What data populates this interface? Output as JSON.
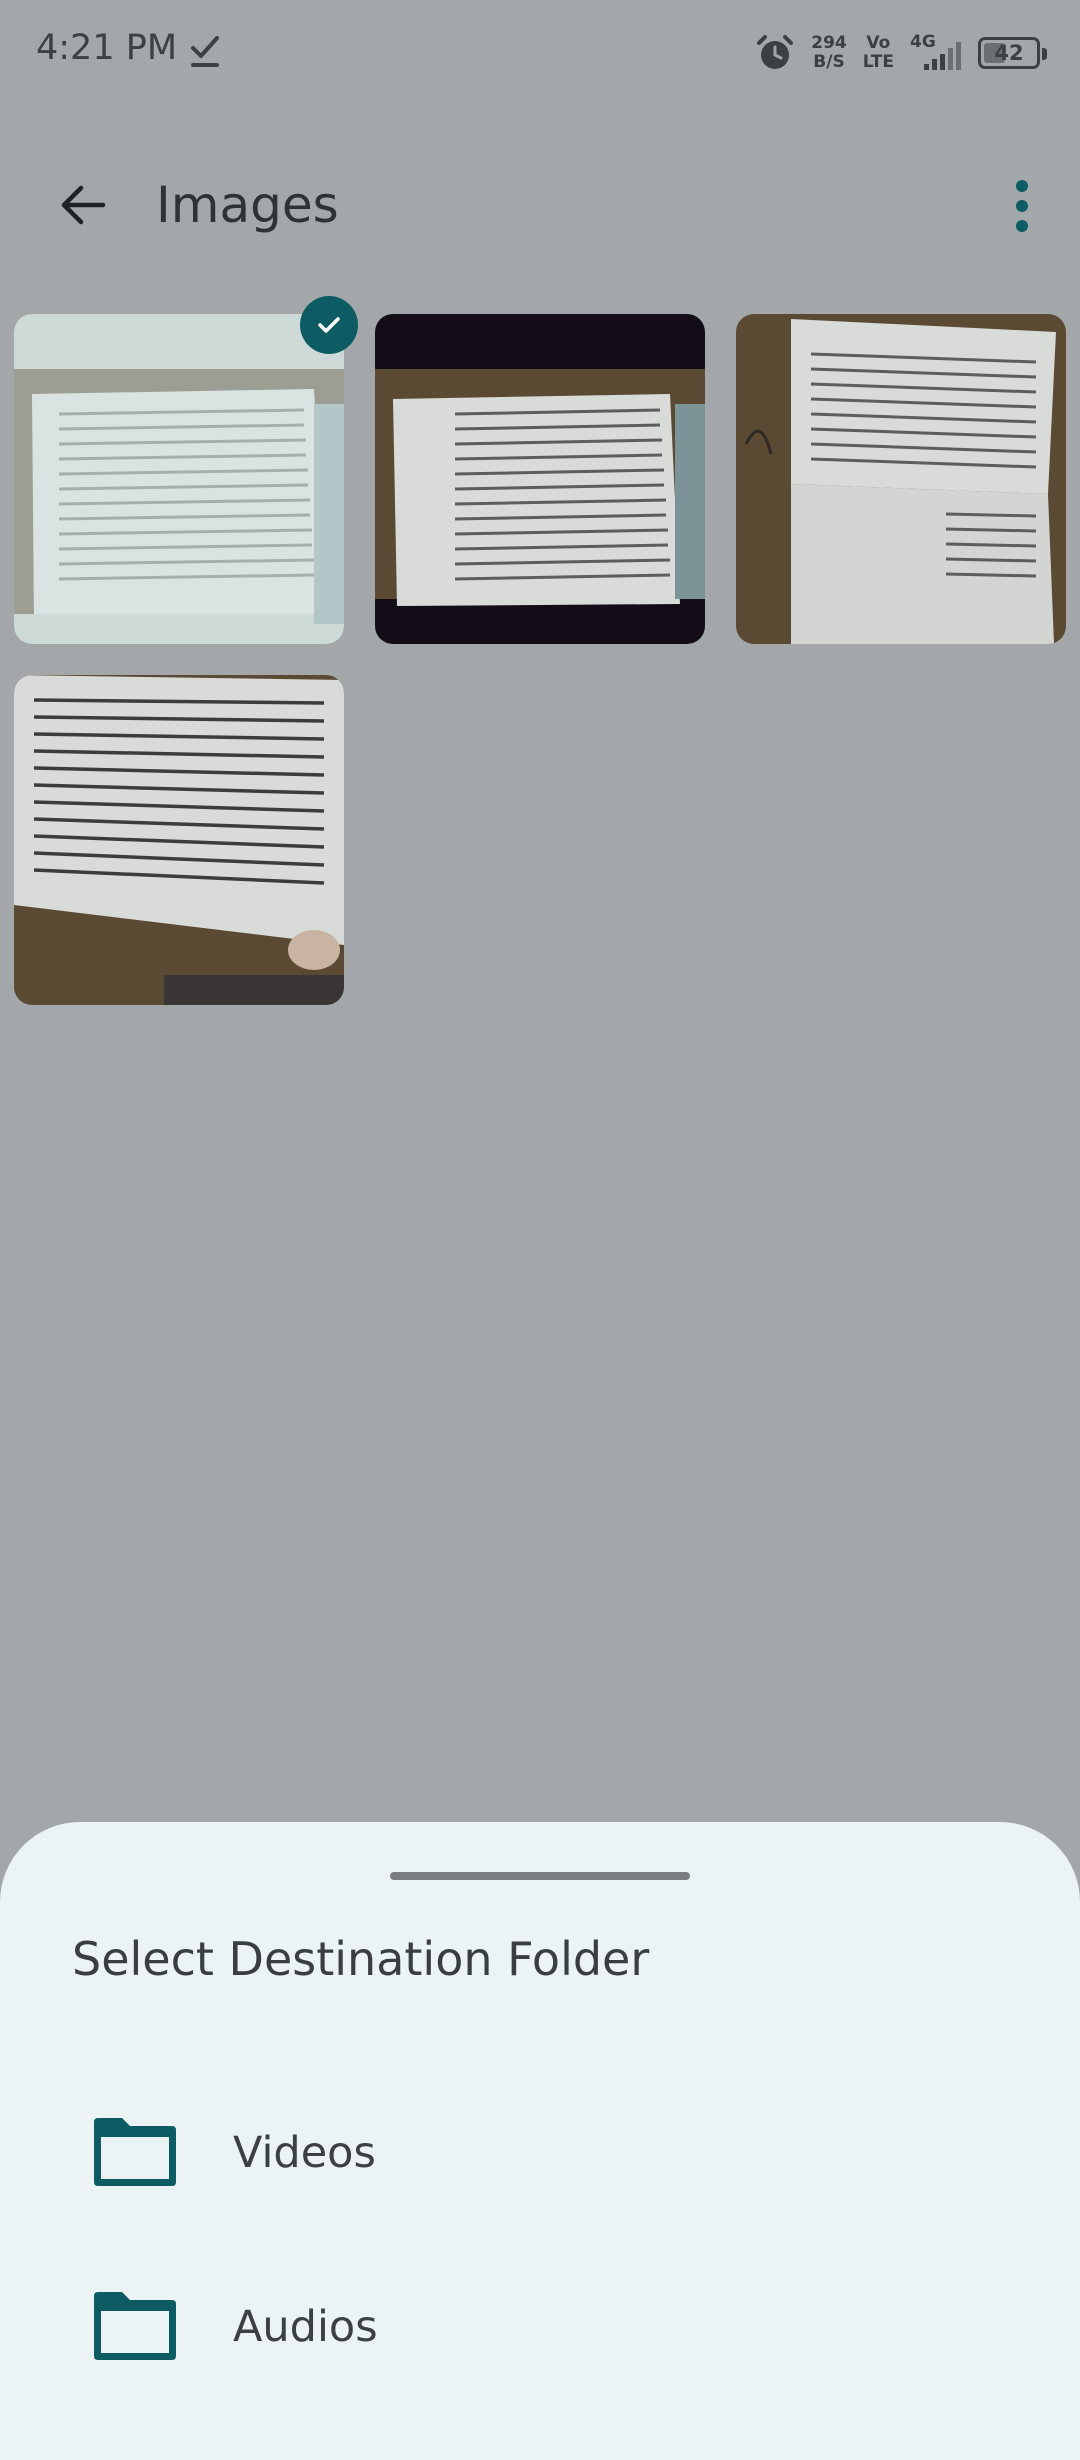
{
  "status_bar": {
    "time": "4:21 PM",
    "net_speed_value": "294",
    "net_speed_unit": "B/S",
    "volte_top": "Vo",
    "volte_bottom": "LTE",
    "network": "4G",
    "battery": "42",
    "battery_level": 0.42
  },
  "app_bar": {
    "title": "Images",
    "back_icon": "arrow-left-icon",
    "menu_icon": "more-vertical-icon"
  },
  "images": [
    {
      "selected": true
    },
    {
      "selected": false
    },
    {
      "selected": false
    },
    {
      "selected": false
    }
  ],
  "sheet": {
    "title": "Select Destination Folder",
    "folders": [
      {
        "label": "Videos",
        "icon": "folder-icon"
      },
      {
        "label": "Audios",
        "icon": "folder-icon"
      }
    ]
  },
  "colors": {
    "accent": "#0d5c63",
    "scrim": "#a3a7a9",
    "sheet_bg": "#ecf3f5"
  }
}
